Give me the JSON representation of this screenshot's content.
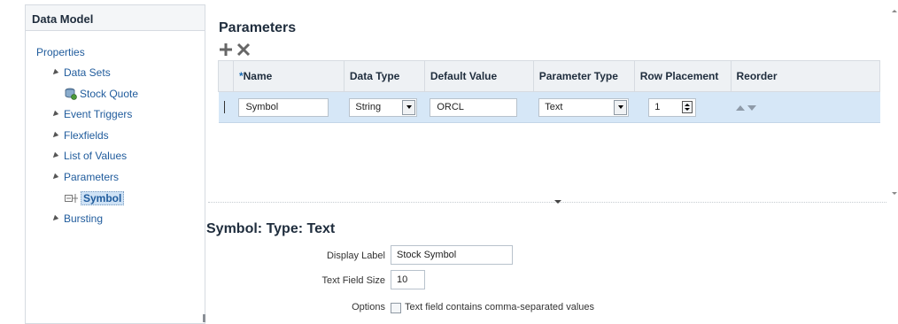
{
  "left_panel": {
    "title": "Data Model",
    "tree": {
      "properties": "Properties",
      "data_sets": "Data Sets",
      "stock_quote": "Stock Quote",
      "event_triggers": "Event Triggers",
      "flexfields": "Flexfields",
      "list_of_values": "List of Values",
      "parameters": "Parameters",
      "symbol": "Symbol",
      "bursting": "Bursting"
    }
  },
  "parameters": {
    "title": "Parameters",
    "columns": {
      "required_mark": "*",
      "name": "Name",
      "data_type": "Data Type",
      "default_value": "Default Value",
      "parameter_type": "Parameter Type",
      "row_placement": "Row Placement",
      "reorder": "Reorder"
    },
    "row": {
      "name": "Symbol",
      "data_type": "String",
      "default_value": "ORCL",
      "parameter_type": "Text",
      "row_placement": "1"
    }
  },
  "detail": {
    "title": "Symbol: Type: Text",
    "display_label_label": "Display Label",
    "display_label_value": "Stock Symbol",
    "text_field_size_label": "Text Field Size",
    "text_field_size_value": "10",
    "options_label": "Options",
    "options_checkbox_text": "Text field contains comma-separated values",
    "options_checked": false
  },
  "colors": {
    "selected_row": "#d6e7f7",
    "link": "#1f5b9c",
    "header_bg": "#eef1f4"
  }
}
